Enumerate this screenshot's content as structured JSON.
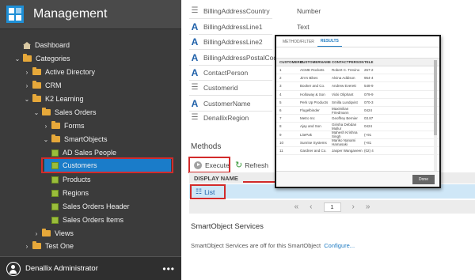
{
  "sidebar": {
    "title": "Management",
    "tree": [
      {
        "label": "Dashboard",
        "icon": "home-icon"
      },
      {
        "label": "Categories",
        "icon": "folder-icon"
      },
      {
        "label": "Active Directory",
        "icon": "folder-icon"
      },
      {
        "label": "CRM",
        "icon": "folder-icon"
      },
      {
        "label": "K2 Learning",
        "icon": "folder-icon"
      },
      {
        "label": "Sales Orders",
        "icon": "folder-icon"
      },
      {
        "label": "Forms",
        "icon": "folder-icon"
      },
      {
        "label": "SmartObjects",
        "icon": "folder-icon"
      },
      {
        "label": "AD Sales People",
        "icon": "smartobject-icon"
      },
      {
        "label": "Customers",
        "icon": "smartobject-icon"
      },
      {
        "label": "Products",
        "icon": "smartobject-icon"
      },
      {
        "label": "Regions",
        "icon": "smartobject-icon"
      },
      {
        "label": "Sales Orders Header",
        "icon": "smartobject-icon"
      },
      {
        "label": "Sales Orders Items",
        "icon": "smartobject-icon"
      },
      {
        "label": "Views",
        "icon": "folder-icon"
      },
      {
        "label": "Test One",
        "icon": "folder-icon"
      }
    ],
    "user": "Denallix Administrator",
    "more": "•••"
  },
  "properties": [
    {
      "name": "BillingAddressCountry",
      "type": "Number",
      "icon": "lines-icon"
    },
    {
      "name": "BillingAddressLine1",
      "type": "Text",
      "icon": "text-icon"
    },
    {
      "name": "BillingAddressLine2",
      "type": "",
      "icon": "text-icon"
    },
    {
      "name": "BillingAddressPostalCode",
      "type": "",
      "icon": "text-icon"
    },
    {
      "name": "ContactPerson",
      "type": "",
      "icon": "text-icon"
    },
    {
      "name": "Customerid",
      "type": "",
      "icon": "lines-icon"
    },
    {
      "name": "CustomerName",
      "type": "",
      "icon": "text-icon"
    },
    {
      "name": "DenallixRegion",
      "type": "",
      "icon": "lines-icon"
    }
  ],
  "methods": {
    "title": "Methods",
    "execute": "Execute",
    "refresh": "Refresh",
    "column": "DISPLAY NAME",
    "list": "List",
    "page": "1"
  },
  "services": {
    "title": "SmartObject Services",
    "text": "SmartObject Services are off for this SmartObject",
    "link": "Configure..."
  },
  "results": {
    "tabs": [
      "METHOD/FILTER",
      "RESULTS"
    ],
    "columns": [
      "CUSTOMERID",
      "CUSTOMERNAME",
      "CONTACTPERSON",
      "TELE"
    ],
    "rows": [
      [
        "1",
        "ACME Rockets",
        "Robert C. Trevino",
        "267-2"
      ],
      [
        "2",
        "Jim's Bikes",
        "Alvina Addison",
        "954-4"
      ],
      [
        "3",
        "Booker and Co.",
        "Andrew Everett",
        "548-9"
      ],
      [
        "4",
        "Holloway & Son",
        "Vicki Oliphant",
        "079-9"
      ],
      [
        "5",
        "Perk Up Products",
        "Smilla Lundqvist",
        "070-3"
      ],
      [
        "6",
        "Flugelbinder",
        "Maximilian Friedmann",
        "0424"
      ],
      [
        "7",
        "Metro Inc",
        "Geoffrey Bernier",
        "03.87"
      ],
      [
        "8",
        "Ajay and Son",
        "Girisha Debdan Mullur",
        "0424"
      ],
      [
        "9",
        "LitePak",
        "Mahesh Krishna Singh",
        "(+91"
      ],
      [
        "10",
        "Sunrise Systems",
        "Mariko Nanami Hamasaki",
        "(+81"
      ],
      [
        "11",
        "Gardner and Co.",
        "Jasper Wangaveen",
        "(02) 4"
      ]
    ],
    "done": "Done"
  },
  "colors": {
    "sidebar": "#3b3b3b",
    "selected": "#1a7cc9",
    "accent": "#1d7ac2",
    "highlight": "#d22b2b"
  }
}
